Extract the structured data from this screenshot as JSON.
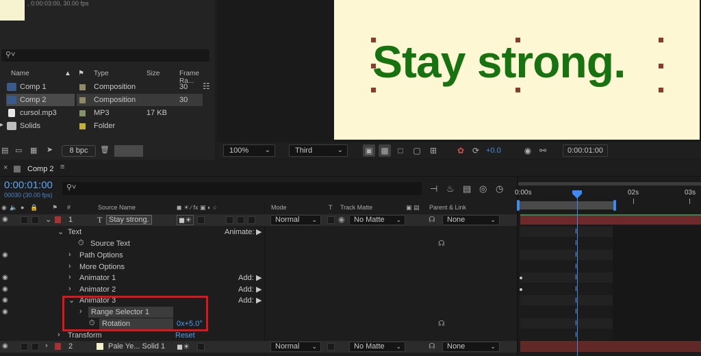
{
  "project": {
    "info": ", 0:00:03:00, 30.00 fps",
    "headers": [
      "Name",
      "Type",
      "Size",
      "Frame Ra..."
    ],
    "items": [
      {
        "name": "Comp 1",
        "type": "Composition",
        "size": "",
        "rate": "30",
        "swatch": "#8f8a66",
        "icon": "composition-icon"
      },
      {
        "name": "Comp 2",
        "type": "Composition",
        "size": "",
        "rate": "30",
        "swatch": "#8f8a66",
        "icon": "composition-icon"
      },
      {
        "name": "cursol.mp3",
        "type": "MP3",
        "size": "17 KB",
        "rate": "",
        "swatch": "#85916a",
        "icon": "audio-file-icon"
      },
      {
        "name": "Solids",
        "type": "Folder",
        "size": "",
        "rate": "",
        "swatch": "#c4b038",
        "icon": "folder-icon"
      }
    ],
    "bpc": "8 bpc"
  },
  "viewer": {
    "canvas_text": "Stay strong.",
    "zoom": "100%",
    "resolution": "Third",
    "exposure": "+0.0",
    "time": "0:00:01:00"
  },
  "timeline": {
    "tab_name": "Comp 2",
    "current_time": "0:00:01:00",
    "frame_info": "00030 (30.00 fps)",
    "col_headers": {
      "num": "#",
      "source": "Source Name",
      "mode": "Mode",
      "t": "T",
      "matte": "Track Matte",
      "parent": "Parent & Link"
    },
    "ruler": [
      "0:00s",
      "02s",
      "03s"
    ],
    "layer1": {
      "num": "1",
      "name": "Stay strong.",
      "mode": "Normal",
      "matte": "No Matte",
      "parent": "None",
      "color": "#a83232"
    },
    "layer2": {
      "num": "2",
      "name": "Pale Ye... Solid 1",
      "mode": "Normal",
      "matte": "No Matte",
      "parent": "None",
      "color": "#a83232",
      "swatch": "#f5f0c8"
    },
    "props": {
      "text": "Text",
      "animate": "Animate:",
      "source_text": "Source Text",
      "path_options": "Path Options",
      "more_options": "More Options",
      "animator1": "Animator 1",
      "animator2": "Animator 2",
      "animator3": "Animator 3",
      "add": "Add:",
      "range_selector": "Range Selector 1",
      "rotation": "Rotation",
      "rotation_value": "0x+5.0°",
      "transform": "Transform",
      "reset": "Reset"
    }
  },
  "colors": {
    "accent_blue": "#3d8bf0",
    "highlight_red": "#e0141b",
    "text_green": "#16730f"
  }
}
